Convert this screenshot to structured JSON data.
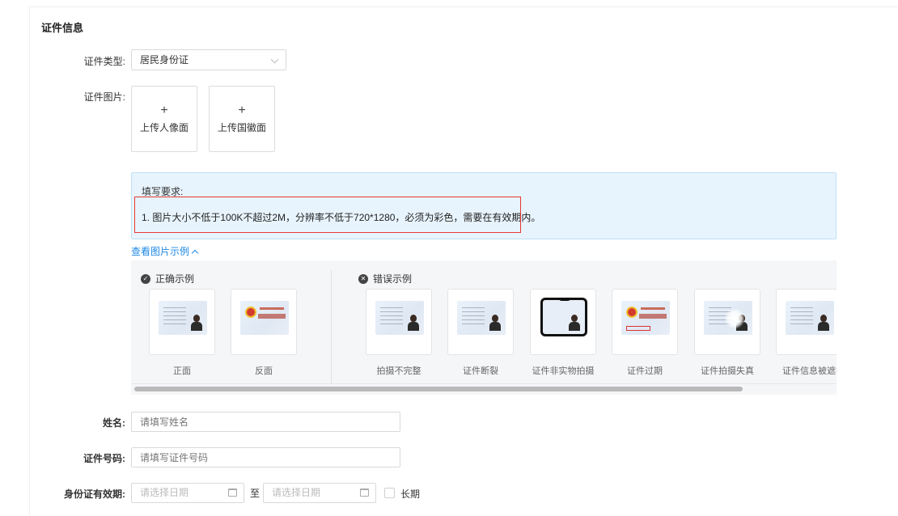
{
  "section": {
    "title": "证件信息"
  },
  "id_type": {
    "label": "证件类型:",
    "value": "居民身份证"
  },
  "id_image": {
    "label": "证件图片:",
    "front_plus": "+",
    "front_label": "上传人像面",
    "back_plus": "+",
    "back_label": "上传国徽面"
  },
  "notice": {
    "title": "填写要求:",
    "line1": "1. 图片大小不低于100K不超过2M，分辨率不低于720*1280，必须为彩色，需要在有效期内。",
    "highlight_color": "#e53935"
  },
  "examples": {
    "toggle_label": "查看图片示例",
    "correct_title": "正确示例",
    "wrong_title": "错误示例",
    "correct_items": [
      "正面",
      "反面"
    ],
    "wrong_items": [
      "拍摄不完整",
      "证件断裂",
      "证件非实物拍摄",
      "证件过期",
      "证件拍摄失真",
      "证件信息被遮挡"
    ]
  },
  "name": {
    "label": "姓名:",
    "placeholder": "请填写姓名"
  },
  "id_number": {
    "label": "证件号码:",
    "placeholder": "请填写证件号码"
  },
  "validity": {
    "label": "身份证有效期:",
    "start_placeholder": "请选择日期",
    "to": "至",
    "end_placeholder": "请选择日期",
    "long_term_label": "长期"
  },
  "colors": {
    "accent": "#1e88e5",
    "notice_bg": "#e8f4fd"
  }
}
